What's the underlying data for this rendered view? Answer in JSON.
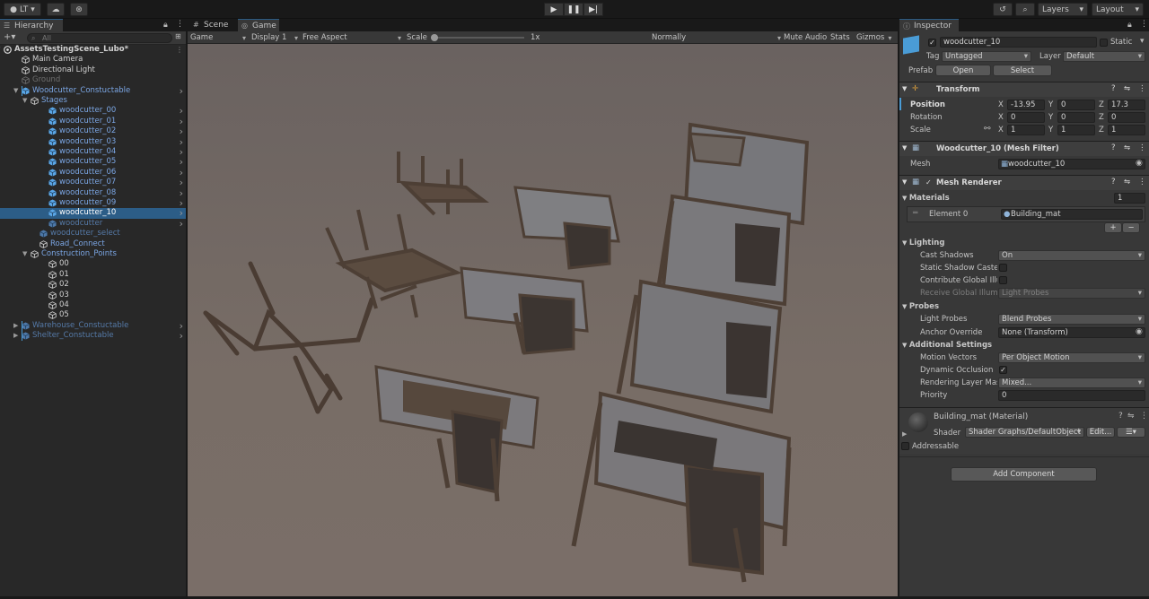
{
  "topbar": {
    "account": "LT",
    "layers": "Layers",
    "layout": "Layout"
  },
  "hierarchy": {
    "tab": "Hierarchy",
    "search_placeholder": "All",
    "rows": [
      {
        "label": "AssetsTestingScene_Lubo*",
        "indent": 0,
        "style": "white",
        "bold": true,
        "icon": "unity-scene-icon",
        "tri": "▼"
      },
      {
        "label": "Main Camera",
        "indent": 2,
        "style": "white",
        "icon": "gameobject-icon"
      },
      {
        "label": "Directional Light",
        "indent": 2,
        "style": "white",
        "icon": "gameobject-icon"
      },
      {
        "label": "Ground",
        "indent": 2,
        "style": "grey",
        "icon": "gameobject-icon"
      },
      {
        "label": "Woodcutter_Constuctable",
        "indent": 2,
        "style": "blue",
        "icon": "prefab-icon",
        "tri": "▼",
        "arrow": true
      },
      {
        "label": "Stages",
        "indent": 3,
        "style": "blue",
        "icon": "gameobject-icon",
        "tri": "▼"
      },
      {
        "label": "woodcutter_00",
        "indent": 5,
        "style": "blue",
        "icon": "prefab-icon",
        "arrow": true
      },
      {
        "label": "woodcutter_01",
        "indent": 5,
        "style": "blue",
        "icon": "prefab-icon",
        "arrow": true
      },
      {
        "label": "woodcutter_02",
        "indent": 5,
        "style": "blue",
        "icon": "prefab-icon",
        "arrow": true
      },
      {
        "label": "woodcutter_03",
        "indent": 5,
        "style": "blue",
        "icon": "prefab-icon",
        "arrow": true
      },
      {
        "label": "woodcutter_04",
        "indent": 5,
        "style": "blue",
        "icon": "prefab-icon",
        "arrow": true
      },
      {
        "label": "woodcutter_05",
        "indent": 5,
        "style": "blue",
        "icon": "prefab-icon",
        "arrow": true
      },
      {
        "label": "woodcutter_06",
        "indent": 5,
        "style": "blue",
        "icon": "prefab-icon",
        "arrow": true
      },
      {
        "label": "woodcutter_07",
        "indent": 5,
        "style": "blue",
        "icon": "prefab-icon",
        "arrow": true
      },
      {
        "label": "woodcutter_08",
        "indent": 5,
        "style": "blue",
        "icon": "prefab-icon",
        "arrow": true
      },
      {
        "label": "woodcutter_09",
        "indent": 5,
        "style": "blue",
        "icon": "prefab-icon",
        "arrow": true
      },
      {
        "label": "woodcutter_10",
        "indent": 5,
        "style": "white",
        "icon": "prefab-icon",
        "arrow": true,
        "selected": true
      },
      {
        "label": "woodcutter",
        "indent": 5,
        "style": "blue-dim",
        "icon": "prefab-icon",
        "arrow": true
      },
      {
        "label": "woodcutter_select",
        "indent": 4,
        "style": "blue-dim",
        "icon": "prefab-icon"
      },
      {
        "label": "Road_Connect",
        "indent": 4,
        "style": "blue",
        "icon": "gameobject-icon"
      },
      {
        "label": "Construction_Points",
        "indent": 3,
        "style": "blue",
        "icon": "gameobject-icon",
        "tri": "▼"
      },
      {
        "label": "00",
        "indent": 5,
        "style": "white",
        "icon": "gameobject-icon"
      },
      {
        "label": "01",
        "indent": 5,
        "style": "white",
        "icon": "gameobject-icon"
      },
      {
        "label": "02",
        "indent": 5,
        "style": "white",
        "icon": "gameobject-icon"
      },
      {
        "label": "03",
        "indent": 5,
        "style": "white",
        "icon": "gameobject-icon"
      },
      {
        "label": "04",
        "indent": 5,
        "style": "white",
        "icon": "gameobject-icon"
      },
      {
        "label": "05",
        "indent": 5,
        "style": "white",
        "icon": "gameobject-icon"
      },
      {
        "label": "Warehouse_Constuctable",
        "indent": 2,
        "style": "blue-dim",
        "icon": "prefab-icon",
        "tri": "▶",
        "arrow": true
      },
      {
        "label": "Shelter_Constuctable",
        "indent": 2,
        "style": "blue-dim",
        "icon": "prefab-icon",
        "tri": "▶",
        "arrow": true
      }
    ]
  },
  "game": {
    "tab_scene": "Scene",
    "tab_game": "Game",
    "mode": "Game",
    "display": "Display 1",
    "aspect": "Free Aspect",
    "scale_label": "Scale",
    "scale_value": "1x",
    "scale_level": 0.0,
    "vsync": "Normally",
    "mute": "Mute Audio",
    "stats": "Stats",
    "gizmos": "Gizmos"
  },
  "inspector": {
    "tab": "Inspector",
    "object_name": "woodcutter_10",
    "static_label": "Static",
    "tag_label": "Tag",
    "tag_value": "Untagged",
    "layer_label": "Layer",
    "layer_value": "Default",
    "prefab_label": "Prefab",
    "open_label": "Open",
    "select_label": "Select",
    "transform": {
      "title": "Transform",
      "position_label": "Position",
      "rotation_label": "Rotation",
      "scale_label": "Scale",
      "pos": {
        "x": "-13.95",
        "y": "0",
        "z": "17.3"
      },
      "rot": {
        "x": "0",
        "y": "0",
        "z": "0"
      },
      "scl": {
        "x": "1",
        "y": "1",
        "z": "1"
      },
      "axis_x": "X",
      "axis_y": "Y",
      "axis_z": "Z"
    },
    "mesh_filter": {
      "title": "Woodcutter_10 (Mesh Filter)",
      "mesh_label": "Mesh",
      "mesh_value": "woodcutter_10"
    },
    "mesh_renderer": {
      "title": "Mesh Renderer",
      "materials_label": "Materials",
      "materials_count": "1",
      "element_label": "Element 0",
      "element_value": "Building_mat",
      "lighting": "Lighting",
      "cast_shadows_label": "Cast Shadows",
      "cast_shadows_value": "On",
      "static_shadow_label": "Static Shadow Caster",
      "contribute_gi_label": "Contribute Global Illumination",
      "receive_gi_label": "Receive Global Illumination",
      "receive_gi_value": "Light Probes",
      "probes": "Probes",
      "light_probes_label": "Light Probes",
      "light_probes_value": "Blend Probes",
      "anchor_label": "Anchor Override",
      "anchor_value": "None (Transform)",
      "additional": "Additional Settings",
      "motion_label": "Motion Vectors",
      "motion_value": "Per Object Motion",
      "dynamic_occlusion_label": "Dynamic Occlusion",
      "rendering_layer_label": "Rendering Layer Mask",
      "rendering_layer_value": "Mixed...",
      "priority_label": "Priority",
      "priority_value": "0"
    },
    "material": {
      "title": "Building_mat (Material)",
      "shader_label": "Shader",
      "shader_value": "Shader Graphs/DefaultObject",
      "edit_label": "Edit...",
      "addressable_label": "Addressable"
    },
    "add_component": "Add Component"
  }
}
